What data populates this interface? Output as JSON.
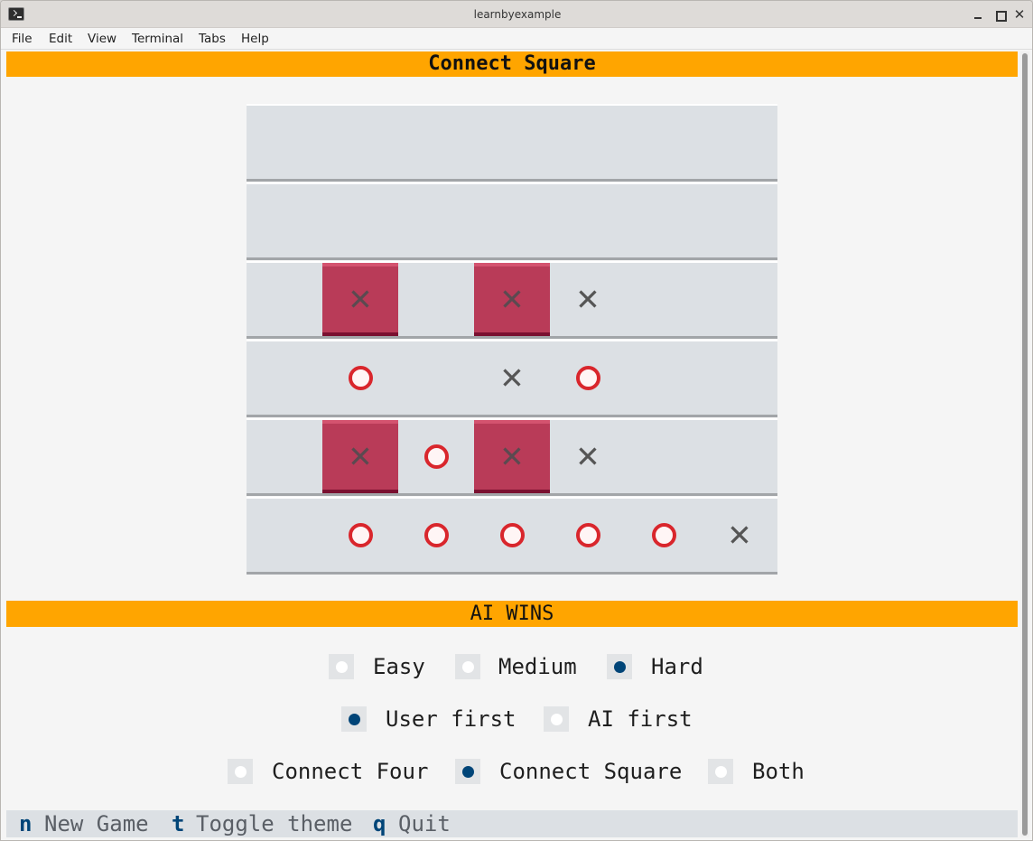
{
  "window": {
    "title": "learnbyexample"
  },
  "menu": [
    "File",
    "Edit",
    "View",
    "Terminal",
    "Tabs",
    "Help"
  ],
  "game": {
    "title": "Connect Square",
    "status": "AI WINS",
    "board": [
      [
        "",
        "",
        "",
        "",
        "",
        "",
        ""
      ],
      [
        "",
        "",
        "",
        "",
        "",
        "",
        ""
      ],
      [
        "",
        "X*",
        "",
        "X*",
        "X",
        "",
        ""
      ],
      [
        "",
        "O",
        "",
        "X",
        "O",
        "",
        ""
      ],
      [
        "",
        "X*",
        "O",
        "X*",
        "X",
        "",
        ""
      ],
      [
        "",
        "O",
        "O",
        "O",
        "O",
        "O",
        "X"
      ]
    ],
    "win_color": "#b93b58",
    "header_color": "#ffa500"
  },
  "options": {
    "difficulty": [
      {
        "label": "Easy",
        "selected": false
      },
      {
        "label": "Medium",
        "selected": false
      },
      {
        "label": "Hard",
        "selected": true
      }
    ],
    "first": [
      {
        "label": "User first",
        "selected": true
      },
      {
        "label": "AI first",
        "selected": false
      }
    ],
    "mode": [
      {
        "label": "Connect Four",
        "selected": false
      },
      {
        "label": "Connect Square",
        "selected": true
      },
      {
        "label": "Both",
        "selected": false
      }
    ]
  },
  "footer": [
    {
      "key": "n",
      "desc": "New Game"
    },
    {
      "key": "t",
      "desc": "Toggle theme"
    },
    {
      "key": "q",
      "desc": "Quit"
    }
  ]
}
